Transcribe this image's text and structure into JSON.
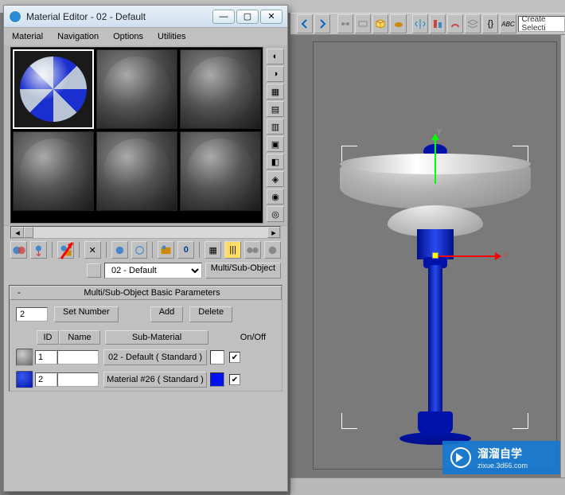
{
  "topmenu": {
    "items": []
  },
  "maintoolbar": {
    "icons": [
      "undo-icon",
      "redo-icon",
      "link-icon",
      "select-icon",
      "cube-icon",
      "sphere-icon",
      "teapot-icon",
      "mirror-icon",
      "align-icon",
      "layers-icon",
      "abc-icon"
    ],
    "create_selection_label": "Create Selecti"
  },
  "viewport": {
    "gizmo": {
      "xlabel": "x",
      "ylabel": "y"
    }
  },
  "material_editor": {
    "title": "Material Editor - 02 - Default",
    "window": {
      "min": "min",
      "max": "max",
      "close": "close"
    },
    "menu": {
      "material": "Material",
      "navigation": "Navigation",
      "options": "Options",
      "utilities": "Utilities"
    },
    "side_tools": [
      "sample-type-icon",
      "backlight-icon",
      "background-icon",
      "checker-icon",
      "color-icon",
      "tile-icon",
      "video-icon",
      "options-icon",
      "material-id-icon",
      "navigator-icon"
    ],
    "toolbar": {
      "icons": [
        "get-material-icon",
        "put-to-scene-icon",
        "assign-to-selection-icon",
        "reset-map-icon",
        "make-unique-icon",
        "put-to-library-icon",
        "material-id-icon",
        "show-map-icon",
        "show-end-result-icon",
        "go-parent-icon",
        "go-sibling-icon"
      ]
    },
    "name_field": "02 - Default",
    "type_button": "Multi/Sub-Object",
    "rollout": {
      "title": "Multi/Sub-Object Basic Parameters",
      "count": "2",
      "set_number": "Set Number",
      "add": "Add",
      "delete": "Delete",
      "headers": {
        "id": "ID",
        "name": "Name",
        "submat": "Sub-Material",
        "onoff": "On/Off"
      },
      "rows": [
        {
          "id": "1",
          "name": "",
          "submat": "02 - Default  ( Standard )",
          "on": true,
          "color": "#ffffff"
        },
        {
          "id": "2",
          "name": "",
          "submat": "Material #26  ( Standard )",
          "on": true,
          "color": "#0012f0"
        }
      ]
    }
  },
  "watermark": {
    "line1": "溜溜自学",
    "line2": "zixue.3d66.com"
  }
}
